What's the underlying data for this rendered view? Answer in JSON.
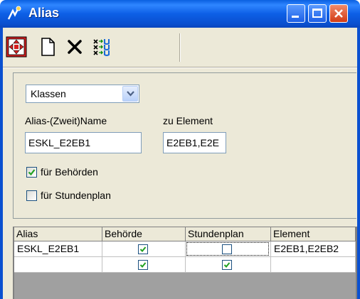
{
  "window": {
    "title": "Alias"
  },
  "toolbar": {
    "icons": [
      "move-icon",
      "new-document-icon",
      "delete-icon",
      "swap-columns-icon"
    ]
  },
  "form": {
    "type_select": {
      "value": "Klassen"
    },
    "alias_label": "Alias-(Zweit)Name",
    "alias_value": "ESKL_E2EB1",
    "element_label": "zu Element",
    "element_value": "E2EB1,E2E",
    "chk_behoerden": {
      "label": "für Behörden",
      "checked": true
    },
    "chk_stundenplan": {
      "label": "für Stundenplan",
      "checked": false
    }
  },
  "grid": {
    "headers": [
      "Alias",
      "Behörde",
      "Stundenplan",
      "Element"
    ],
    "rows": [
      {
        "alias": "ESKL_E2EB1",
        "behoerde": true,
        "stundenplan": false,
        "element": "E2EB1,E2EB2"
      },
      {
        "alias": "",
        "behoerde": true,
        "stundenplan": true,
        "element": ""
      }
    ]
  },
  "colors": {
    "titlebar": "#0a5fe0",
    "face": "#ece9d8",
    "check": "#21a121"
  }
}
